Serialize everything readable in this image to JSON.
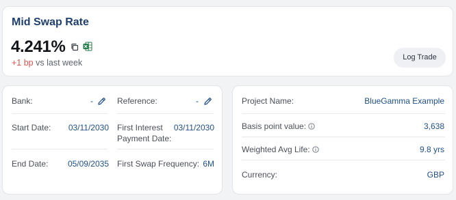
{
  "header": {
    "title": "Mid Swap Rate",
    "rate": "4.241%",
    "change_delta": "+1 bp",
    "change_suffix": " vs last week",
    "log_trade_label": "Log Trade"
  },
  "trade_details": {
    "bank_label": "Bank:",
    "bank_value": "-",
    "reference_label": "Reference:",
    "reference_value": "-",
    "start_date_label": "Start Date:",
    "start_date_value": "03/11/2030",
    "first_interest_label_line1": "First Interest",
    "first_interest_label_line2": "Payment Date:",
    "first_interest_value": "03/11/2030",
    "end_date_label": "End Date:",
    "end_date_value": "05/09/2035",
    "first_swap_freq_label": "First Swap Frequency:",
    "first_swap_freq_value": "6M"
  },
  "project": {
    "project_name_label": "Project Name:",
    "project_name_value": "BlueGamma Example",
    "bpv_label": "Basis point value:",
    "bpv_value": "3,638",
    "wal_label": "Weighted Avg Life:",
    "wal_value": "9.8 yrs",
    "currency_label": "Currency:",
    "currency_value": "GBP"
  },
  "colors": {
    "accent": "#1f3f6e",
    "value_blue": "#1f4f8a",
    "delta_red": "#d9534f",
    "excel_green": "#1f7a45"
  }
}
